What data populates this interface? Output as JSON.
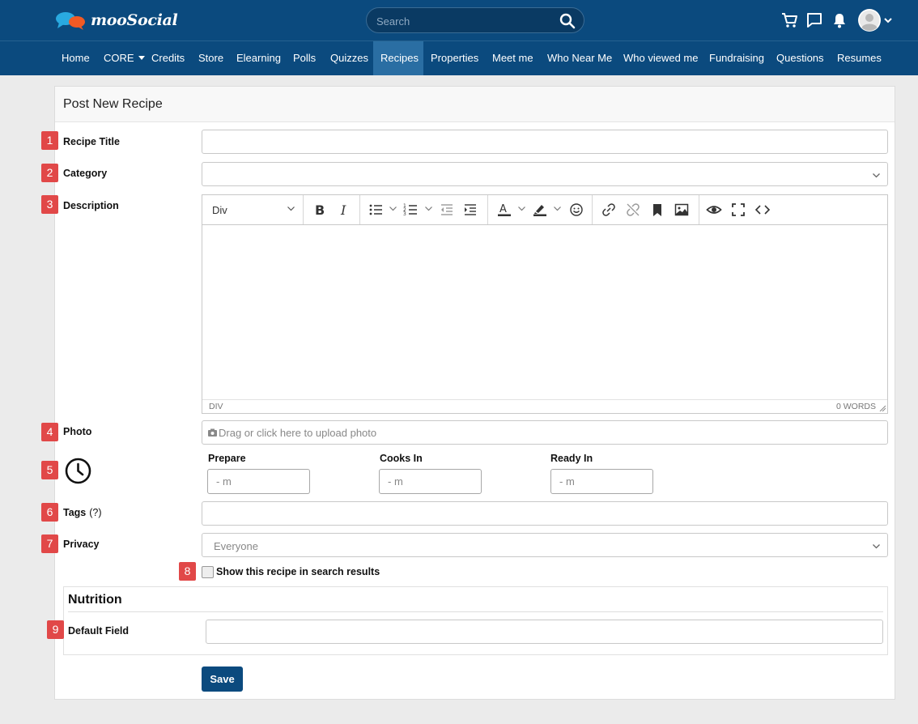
{
  "app": {
    "logo_text": "mooSocial",
    "search_placeholder": "Search"
  },
  "header_icons": [
    "cart-icon",
    "chat-icon",
    "bell-icon",
    "user-avatar"
  ],
  "nav": {
    "items": [
      {
        "label": "Home",
        "active": false
      },
      {
        "label": "CORE",
        "active": false,
        "dropdown": true
      },
      {
        "label": "Credits",
        "active": false
      },
      {
        "label": "Store",
        "active": false
      },
      {
        "label": "Elearning",
        "active": false
      },
      {
        "label": "Polls",
        "active": false
      },
      {
        "label": "Quizzes",
        "active": false
      },
      {
        "label": "Recipes",
        "active": true
      },
      {
        "label": "Properties",
        "active": false
      },
      {
        "label": "Meet me",
        "active": false
      },
      {
        "label": "Who Near Me",
        "active": false
      },
      {
        "label": "Who viewed me",
        "active": false
      },
      {
        "label": "Fundraising",
        "active": false
      },
      {
        "label": "Questions",
        "active": false
      },
      {
        "label": "Resumes",
        "active": false
      }
    ]
  },
  "form": {
    "title": "Post New Recipe",
    "badges": [
      "1",
      "2",
      "3",
      "4",
      "5",
      "6",
      "7",
      "8",
      "9"
    ],
    "recipe_title_label": "Recipe Title",
    "recipe_title_value": "",
    "category_label": "Category",
    "category_value": "",
    "description_label": "Description",
    "editor": {
      "format_value": "Div",
      "status_path": "DIV",
      "word_count": "0 WORDS"
    },
    "photo_label": "Photo",
    "photo_placeholder": "Drag or click here to upload photo",
    "time": {
      "prepare_label": "Prepare",
      "cooks_in_label": "Cooks In",
      "ready_in_label": "Ready In",
      "placeholder": "- m"
    },
    "tags_label": "Tags",
    "tags_help": "(?)",
    "tags_value": "",
    "privacy_label": "Privacy",
    "privacy_value": "Everyone",
    "show_in_search_label": "Show this recipe in search results",
    "show_in_search_checked": false,
    "nutrition_title": "Nutrition",
    "default_field_label": "Default Field",
    "default_field_value": "",
    "save_label": "Save"
  },
  "colors": {
    "header": "#0b4a7e",
    "active_nav": "#2a6ea3",
    "badge": "#e14848",
    "save_button": "#0b4a7e"
  }
}
